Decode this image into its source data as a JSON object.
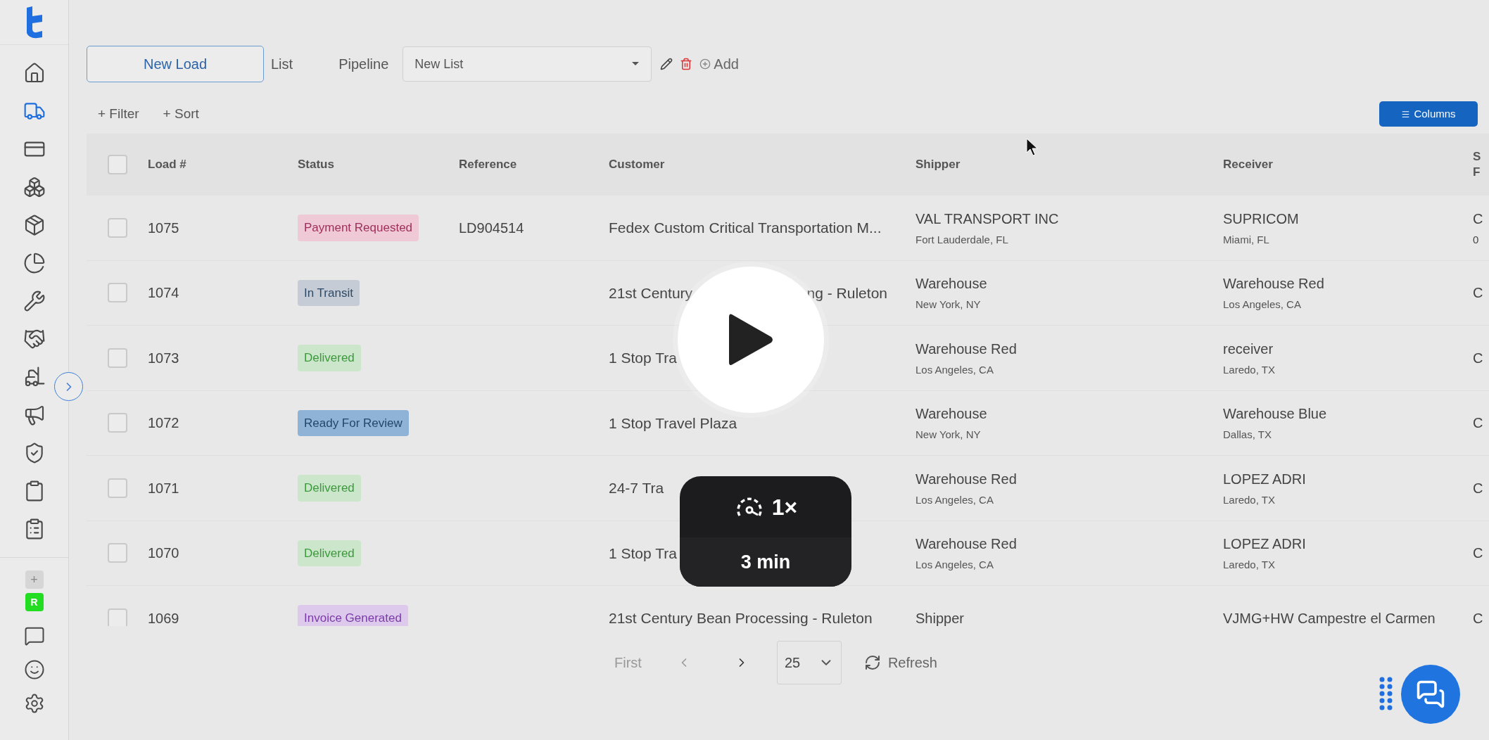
{
  "sidebar": {
    "nav_items": [
      {
        "selected": false
      },
      {
        "selected": true
      },
      {
        "selected": false
      },
      {
        "selected": false
      },
      {
        "selected": false
      },
      {
        "selected": false
      },
      {
        "selected": false
      },
      {
        "selected": false
      },
      {
        "selected": false
      },
      {
        "selected": false
      },
      {
        "selected": false
      },
      {
        "selected": false
      },
      {
        "selected": false
      }
    ],
    "add_label": "+",
    "workspace_initial": "R"
  },
  "toolbar": {
    "new_load": "New Load",
    "tabs": [
      "List",
      "Pipeline"
    ],
    "list_select": "New List",
    "add": "Add"
  },
  "filters": {
    "filter": "+ Filter",
    "sort": "+ Sort",
    "columns": "Columns"
  },
  "table": {
    "select_all_checked": false,
    "columns": [
      "Load #",
      "Status",
      "Reference",
      "Customer",
      "Shipper",
      "Receiver"
    ],
    "column_7": [
      "S",
      "F"
    ],
    "rows": [
      {
        "checked": false,
        "load": "1075",
        "status": {
          "label": "Payment Requested",
          "kind": "payment_requested"
        },
        "reference": "LD904514",
        "customer": "Fedex Custom Critical Transportation M...",
        "shipper": {
          "name": "VAL TRANSPORT INC",
          "location": "Fort Lauderdale, FL"
        },
        "receiver": {
          "name": "SUPRICOM",
          "location": "Miami, FL"
        },
        "column_7": [
          "C",
          "0"
        ]
      },
      {
        "checked": false,
        "load": "1074",
        "status": {
          "label": "In Transit",
          "kind": "in_transit"
        },
        "customer": "21st Century",
        "customer_tail": "ng - Ruleton",
        "shipper": {
          "name": "Warehouse",
          "location": "New York, NY"
        },
        "receiver": {
          "name": "Warehouse Red",
          "location": "Los Angeles, CA"
        },
        "column_7": [
          "C"
        ]
      },
      {
        "checked": false,
        "load": "1073",
        "status": {
          "label": "Delivered",
          "kind": "delivered"
        },
        "customer": "1 Stop Tra",
        "shipper": {
          "name": "Warehouse Red",
          "location": "Los Angeles, CA"
        },
        "receiver": {
          "name": "receiver",
          "location": "Laredo, TX"
        },
        "column_7": [
          "C"
        ]
      },
      {
        "checked": false,
        "load": "1072",
        "status": {
          "label": "Ready For Review",
          "kind": "ready_for_review"
        },
        "customer": "1 Stop Travel Plaza",
        "shipper": {
          "name": "Warehouse",
          "location": "New York, NY"
        },
        "receiver": {
          "name": "Warehouse Blue",
          "location": "Dallas, TX"
        },
        "column_7": [
          "C"
        ]
      },
      {
        "checked": false,
        "load": "1071",
        "status": {
          "label": "Delivered",
          "kind": "delivered"
        },
        "customer": "24-7 Tra",
        "shipper": {
          "name": "Warehouse Red",
          "location": "Los Angeles, CA"
        },
        "receiver": {
          "name": "LOPEZ ADRI",
          "location": "Laredo, TX"
        },
        "column_7": [
          "C"
        ]
      },
      {
        "checked": false,
        "load": "1070",
        "status": {
          "label": "Delivered",
          "kind": "delivered"
        },
        "customer": "1 Stop Tra",
        "shipper": {
          "name": "Warehouse Red",
          "location": "Los Angeles, CA"
        },
        "receiver": {
          "name": "LOPEZ ADRI",
          "location": "Laredo, TX"
        },
        "column_7": [
          "C"
        ]
      },
      {
        "checked": false,
        "load": "1069",
        "status": {
          "label": "Invoice Generated",
          "kind": "invoice_generated"
        },
        "customer": "21st Century Bean Processing - Ruleton",
        "shipper": {
          "name": "Shipper"
        },
        "receiver": {
          "name": "VJMG+HW Campestre el Carmen"
        },
        "column_7": [
          "C"
        ]
      }
    ]
  },
  "pagination": {
    "first": "First",
    "first_disabled": true,
    "per_page": "25",
    "refresh": "Refresh"
  },
  "video_overlay": {
    "speed": "1×",
    "duration": "3 min"
  }
}
